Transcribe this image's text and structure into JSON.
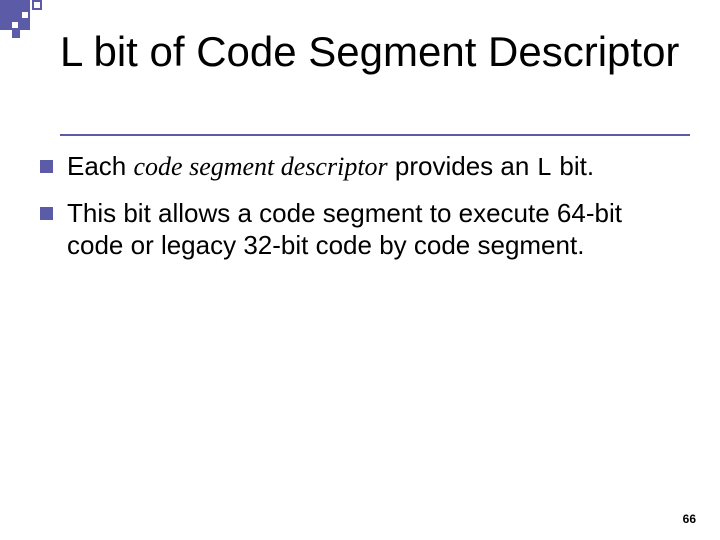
{
  "slide": {
    "title": "L bit of Code Segment Descriptor",
    "bullets": [
      {
        "pre": "Each ",
        "italic": "code segment descriptor",
        "mid": " provides an ",
        "mono": "L",
        "post": " bit."
      },
      {
        "text": "This bit allows a code segment to execute 64-bit code or legacy 32-bit code by code segment."
      }
    ],
    "page_number": "66"
  }
}
